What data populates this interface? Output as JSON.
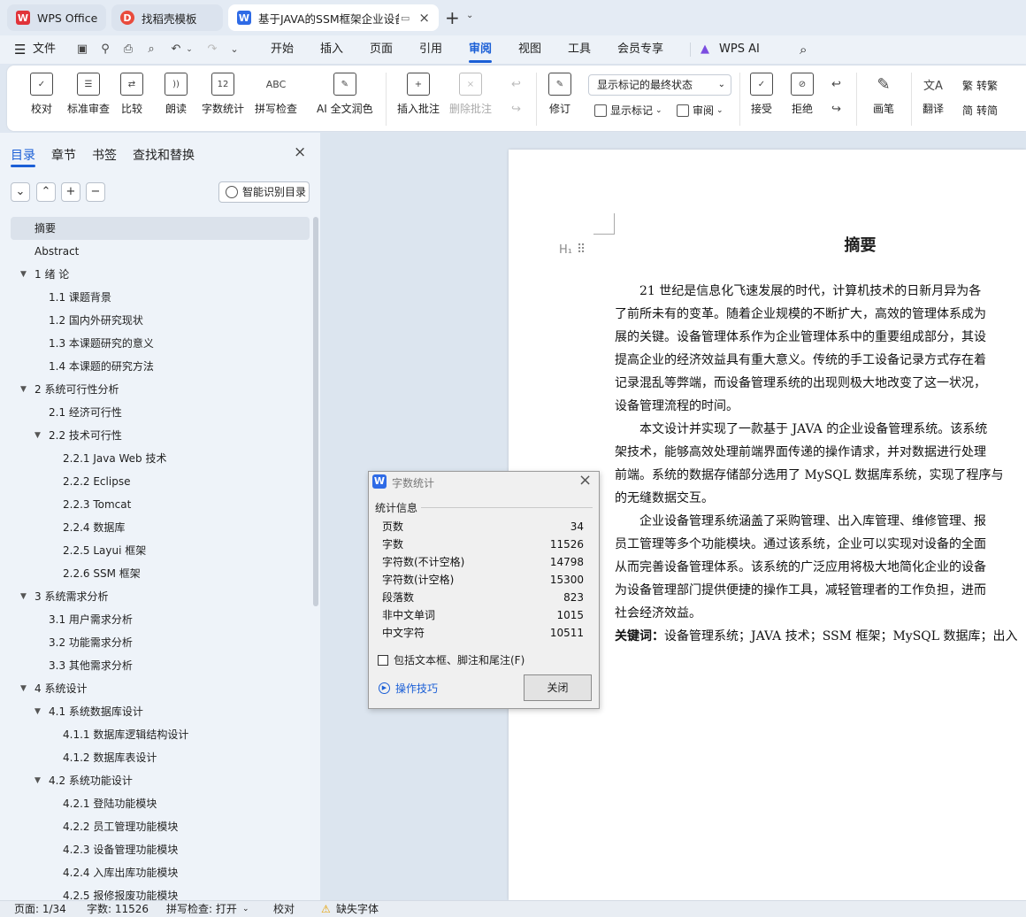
{
  "tabs": [
    {
      "label": "WPS Office",
      "icon": "wps-icon",
      "color": "#e1343a"
    },
    {
      "label": "找稻壳模板",
      "icon": "docer-icon",
      "color": "#e94b3c"
    },
    {
      "label": "基于JAVA的SSM框架企业设备",
      "icon": "writer-icon",
      "color": "#2f6be6"
    }
  ],
  "tab_new": "+",
  "menu": {
    "file": "文件",
    "items": [
      "开始",
      "插入",
      "页面",
      "引用",
      "审阅",
      "视图",
      "工具",
      "会员专享"
    ],
    "active": "审阅",
    "ai": "WPS AI"
  },
  "ribbon": {
    "buttons": [
      "校对",
      "标准审查",
      "比较",
      "朗读",
      "字数统计",
      "拼写检查",
      "AI 全文润色",
      "插入批注",
      "删除批注",
      "修订"
    ],
    "show_markup_select": "显示标记的最终状态",
    "show_markup": "显示标记",
    "review": "审阅",
    "accept": "接受",
    "reject": "拒绝",
    "ink": "画笔",
    "translate": "翻译",
    "to_traditional": "转繁",
    "to_simplified": "转简"
  },
  "panel": {
    "tabs": [
      "目录",
      "章节",
      "书签",
      "查找和替换"
    ],
    "smart_toc": "智能识别目录",
    "toc": [
      {
        "text": "摘要",
        "level": 0,
        "selected": true
      },
      {
        "text": "Abstract",
        "level": 0
      },
      {
        "text": "1  绪  论",
        "level": 0,
        "expand": true
      },
      {
        "text": "1.1  课题背景",
        "level": 1
      },
      {
        "text": "1.2  国内外研究现状",
        "level": 1
      },
      {
        "text": "1.3  本课题研究的意义",
        "level": 1
      },
      {
        "text": "1.4  本课题的研究方法",
        "level": 1
      },
      {
        "text": "2  系统可行性分析",
        "level": 0,
        "expand": true
      },
      {
        "text": "2.1  经济可行性",
        "level": 1
      },
      {
        "text": "2.2  技术可行性",
        "level": 1,
        "expand": true
      },
      {
        "text": "2.2.1 Java Web 技术",
        "level": 2
      },
      {
        "text": "2.2.2 Eclipse",
        "level": 2
      },
      {
        "text": "2.2.3 Tomcat",
        "level": 2
      },
      {
        "text": "2.2.4  数据库",
        "level": 2
      },
      {
        "text": "2.2.5  Layui 框架",
        "level": 2
      },
      {
        "text": "2.2.6 SSM  框架",
        "level": 2
      },
      {
        "text": "3  系统需求分析",
        "level": 0,
        "expand": true
      },
      {
        "text": "3.1  用户需求分析",
        "level": 1
      },
      {
        "text": "3.2  功能需求分析",
        "level": 1
      },
      {
        "text": "3.3  其他需求分析",
        "level": 1
      },
      {
        "text": "4  系统设计",
        "level": 0,
        "expand": true
      },
      {
        "text": "4.1  系统数据库设计",
        "level": 1,
        "expand": true
      },
      {
        "text": "4.1.1  数据库逻辑结构设计",
        "level": 2
      },
      {
        "text": "4.1.2  数据库表设计",
        "level": 2
      },
      {
        "text": "4.2  系统功能设计",
        "level": 1,
        "expand": true
      },
      {
        "text": "4.2.1  登陆功能模块",
        "level": 2
      },
      {
        "text": "4.2.2  员工管理功能模块",
        "level": 2
      },
      {
        "text": "4.2.3  设备管理功能模块",
        "level": 2
      },
      {
        "text": "4.2.4  入库出库功能模块",
        "level": 2
      },
      {
        "text": "4.2.5  报修报废功能模块",
        "level": 2
      }
    ]
  },
  "document": {
    "title": "摘要",
    "lines": [
      "　　21 世纪是信息化飞速发展的时代，计算机技术的日新月异为各",
      "了前所未有的变革。随着企业规模的不断扩大，高效的管理体系成为",
      "展的关键。设备管理体系作为企业管理体系中的重要组成部分，其设",
      "提高企业的经济效益具有重大意义。传统的手工设备记录方式存在着",
      "记录混乱等弊端，而设备管理系统的出现则极大地改变了这一状况，",
      "设备管理流程的时间。",
      "　　本文设计并实现了一款基于 JAVA 的企业设备管理系统。该系统",
      "架技术，能够高效处理前端界面传递的操作请求，并对数据进行处理",
      "前端。系统的数据存储部分选用了 MySQL 数据库系统，实现了程序与",
      "的无缝数据交互。",
      "　　企业设备管理系统涵盖了采购管理、出入库管理、维修管理、报",
      "员工管理等多个功能模块。通过该系统，企业可以实现对设备的全面",
      "从而完善设备管理体系。该系统的广泛应用将极大地简化企业的设备",
      "为设备管理部门提供便捷的操作工具，减轻管理者的工作负担，进而",
      "社会经济效益。"
    ],
    "keywords_label": "关键词：",
    "keywords": "设备管理系统；JAVA 技术；SSM 框架；MySQL 数据库；出入"
  },
  "dialog": {
    "title": "字数统计",
    "section": "统计信息",
    "rows": [
      {
        "label": "页数",
        "value": "34"
      },
      {
        "label": "字数",
        "value": "11526"
      },
      {
        "label": "字符数(不计空格)",
        "value": "14798"
      },
      {
        "label": "字符数(计空格)",
        "value": "15300"
      },
      {
        "label": "段落数",
        "value": "823"
      },
      {
        "label": "非中文单词",
        "value": "1015"
      },
      {
        "label": "中文字符",
        "value": "10511"
      }
    ],
    "checkbox": "包括文本框、脚注和尾注(F)",
    "tips": "操作技巧",
    "close": "关闭"
  },
  "status": {
    "page": "页面: 1/34",
    "words": "字数: 11526",
    "spell": "拼写检查: 打开",
    "proof": "校对",
    "missing_font": "缺失字体"
  }
}
